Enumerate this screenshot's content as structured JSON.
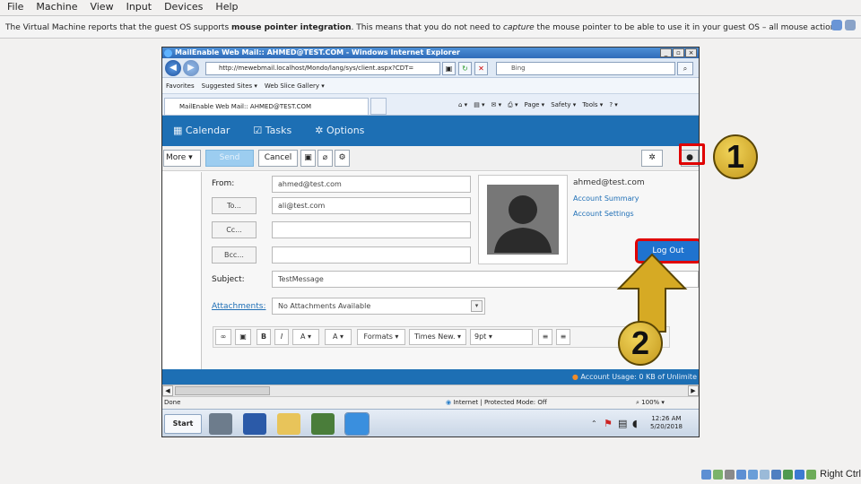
{
  "host_menu": [
    "File",
    "Machine",
    "View",
    "Input",
    "Devices",
    "Help"
  ],
  "notice": {
    "prefix": "The Virtual Machine reports that the guest OS supports ",
    "bold": "mouse pointer integration",
    "middle": ". This means that you do not need to ",
    "italic": "capture",
    "suffix": " the mouse pointer to be able to use it in your guest OS – all mouse actions"
  },
  "ie": {
    "title": "MailEnable Web Mail:: AHMED@TEST.COM - Windows Internet Explorer",
    "address": "http://mewebmail.localhost/Mondo/lang/sys/client.aspx?CDT=",
    "search_placeholder": "Bing",
    "favorites": [
      "Favorites",
      "Suggested Sites ▾",
      "Web Slice Gallery ▾"
    ],
    "tab": "MailEnable Web Mail:: AHMED@TEST.COM",
    "commands": [
      "Page ▾",
      "Safety ▾",
      "Tools ▾"
    ],
    "status_done": "Done",
    "zone": "Internet | Protected Mode: Off",
    "zoom": "100%"
  },
  "app": {
    "nav": [
      {
        "icon": "calendar-icon",
        "label": "Calendar"
      },
      {
        "icon": "tasks-icon",
        "label": "Tasks"
      },
      {
        "icon": "gear-icon",
        "label": "Options"
      }
    ],
    "toolbar": {
      "more": "More",
      "send": "Send",
      "cancel": "Cancel"
    },
    "compose": {
      "from_label": "From:",
      "from_value": "ahmed@test.com",
      "to_label": "To...",
      "to_value": "ali@test.com",
      "cc_label": "Cc...",
      "bcc_label": "Bcc...",
      "subject_label": "Subject:",
      "subject_value": "TestMessage",
      "attachments_label": "Attachments:",
      "attachments_value": "No Attachments Available"
    },
    "editor": {
      "formats": "Formats",
      "font": "Times New.",
      "size": "9pt"
    },
    "contact": {
      "email": "ahmed@test.com",
      "summary": "Account Summary",
      "settings": "Account Settings",
      "logout": "Log Out"
    },
    "usage": "Account Usage: 0 KB of Unlimite"
  },
  "taskbar": {
    "start": "Start",
    "time": "12:26 AM",
    "date": "5/20/2018"
  },
  "callouts": {
    "one": "1",
    "two": "2"
  },
  "host_key": "Right Ctrl"
}
